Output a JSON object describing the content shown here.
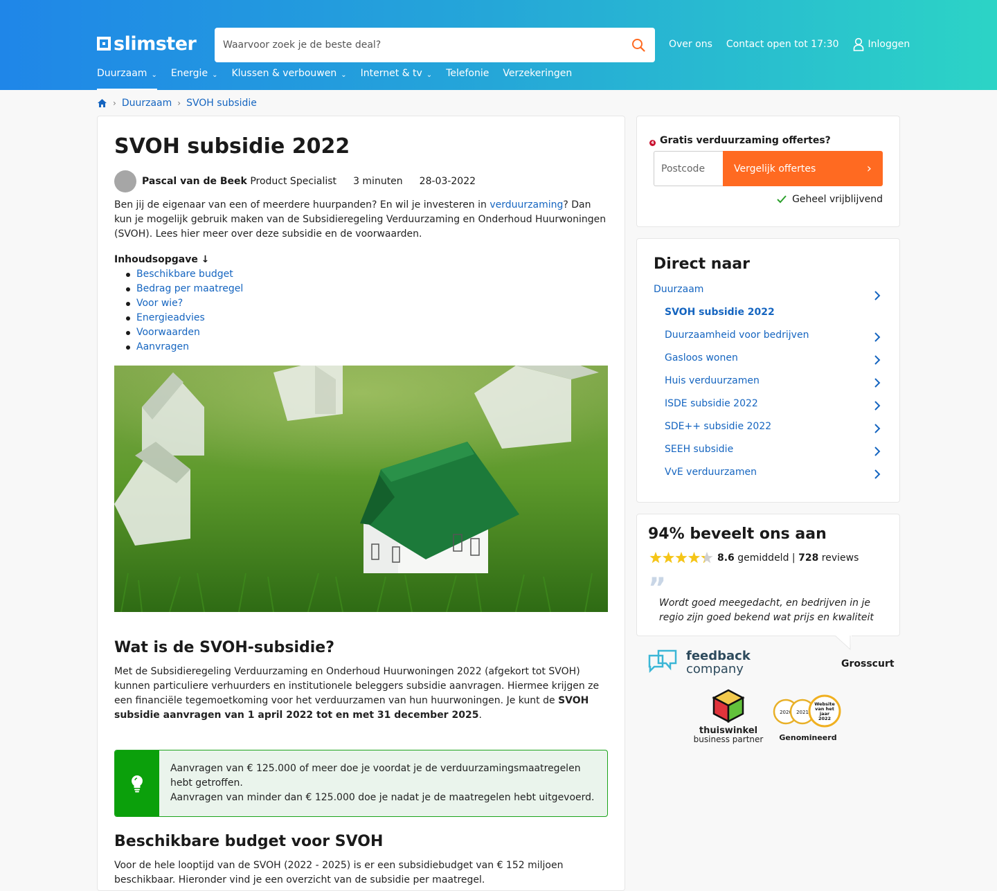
{
  "brand": {
    "name": "slimster"
  },
  "search": {
    "placeholder": "Waarvoor zoek je de beste deal?"
  },
  "toplinks": {
    "about": "Over ons",
    "contact": "Contact open tot 17:30",
    "login": "Inloggen"
  },
  "nav": [
    {
      "label": "Duurzaam",
      "has_menu": true,
      "active": true
    },
    {
      "label": "Energie",
      "has_menu": true
    },
    {
      "label": "Klussen & verbouwen",
      "has_menu": true
    },
    {
      "label": "Internet & tv",
      "has_menu": true
    },
    {
      "label": "Telefonie",
      "has_menu": false
    },
    {
      "label": "Verzekeringen",
      "has_menu": false
    }
  ],
  "breadcrumb": [
    "Duurzaam",
    "SVOH subsidie"
  ],
  "article": {
    "title": "SVOH subsidie 2022",
    "author": "Pascal van de Beek",
    "role": "Product Specialist",
    "read_time": "3 minuten",
    "date": "28-03-2022",
    "intro_pre": "Ben jij de eigenaar van een of meerdere huurpanden? En wil je investeren in ",
    "intro_link": "verduurzaming",
    "intro_post": "? Dan kun je mogelijk gebruik maken van de Subsidieregeling Verduurzaming en Onderhoud Huurwoningen (SVOH). Lees hier meer over deze subsidie en de voorwaarden.",
    "toc_title": "Inhoudsopgave ↓",
    "toc": [
      "Beschikbare budget",
      "Bedrag per maatregel",
      "Voor wie?",
      "Energieadvies",
      "Voorwaarden",
      "Aanvragen"
    ],
    "h2_1": "Wat is de SVOH-subsidie?",
    "p1_pre": "Met de Subsidieregeling Verduurzaming en Onderhoud Huurwoningen 2022 (afgekort tot SVOH) kunnen particuliere verhuurders en institutionele beleggers subsidie aanvragen. Hiermee krijgen ze een financiële tegemoetkoming voor het verduurzamen van hun huurwoningen. Je kunt de ",
    "p1_bold": "SVOH subsidie aanvragen van 1 april 2022 tot en met 31 december 2025",
    "p1_post": ".",
    "tip_line1": "Aanvragen van € 125.000 of meer doe je voordat je de verduurzamingsmaatregelen hebt getroffen.",
    "tip_line2": "Aanvragen van minder dan € 125.000 doe je nadat je de maatregelen hebt uitgevoerd.",
    "h2_2": "Beschikbare budget voor SVOH",
    "p2": "Voor de hele looptijd van de SVOH (2022 - 2025) is er een subsidiebudget van € 152 miljoen beschikbaar. Hieronder vind je een overzicht van de subsidie per maatregel."
  },
  "offer": {
    "badge": "4",
    "title": "Gratis verduurzaming offertes?",
    "postcode_placeholder": "Postcode",
    "button": "Vergelijk offertes",
    "note": "Geheel vrijblijvend"
  },
  "direct": {
    "title": "Direct naar",
    "items": [
      {
        "label": "Duurzaam",
        "level": 0,
        "arrow": true
      },
      {
        "label": "SVOH subsidie 2022",
        "level": 1,
        "current": true,
        "arrow": false
      },
      {
        "label": "Duurzaamheid voor bedrijven",
        "level": 1,
        "arrow": true
      },
      {
        "label": "Gasloos wonen",
        "level": 1,
        "arrow": true
      },
      {
        "label": "Huis verduurzamen",
        "level": 1,
        "arrow": true
      },
      {
        "label": "ISDE subsidie 2022",
        "level": 1,
        "arrow": true
      },
      {
        "label": "SDE++ subsidie 2022",
        "level": 1,
        "arrow": true
      },
      {
        "label": "SEEH subsidie",
        "level": 1,
        "arrow": true
      },
      {
        "label": "VvE verduurzamen",
        "level": 1,
        "arrow": true
      }
    ]
  },
  "reviews": {
    "title": "94% beveelt ons aan",
    "stars": 4.3,
    "score": "8.6",
    "score_label": "gemiddeld",
    "sep": "|",
    "count": "728",
    "count_label": "reviews",
    "quote": "Wordt goed meegedacht, en bedrijven in je regio zijn goed bekend wat prijs en kwaliteit betreft. Als",
    "reviewer": "Grosscurt"
  },
  "badges": {
    "feedback_line1": "feedback",
    "feedback_line2": "company",
    "tw_line1": "thuiswinkel",
    "tw_line2": "business partner",
    "award_years": [
      "2020",
      "2021"
    ],
    "award_main": [
      "Website",
      "van het",
      "jaar",
      "2022"
    ],
    "award_label": "Genomineerd"
  },
  "colors": {
    "accent": "#ff6a21",
    "link": "#1565c0",
    "tip_green": "#0ba00b",
    "header_start": "#1f86e8",
    "header_end": "#2cd4c6"
  }
}
